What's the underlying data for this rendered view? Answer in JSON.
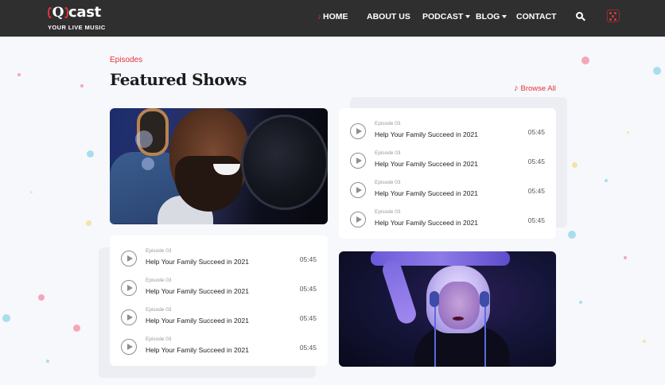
{
  "header": {
    "logo": {
      "mark": "Q",
      "word": "cast",
      "tagline": "YOUR LIVE MUSIC"
    },
    "nav": [
      {
        "label": "HOME",
        "active": true
      },
      {
        "label": "ABOUT US",
        "dropdown": false
      },
      {
        "label": "PODCAST",
        "dropdown": true
      },
      {
        "label": "BLOG",
        "dropdown": true
      },
      {
        "label": "CONTACT",
        "dropdown": false
      }
    ],
    "icons": {
      "search": "search-icon",
      "menu": "menu-grid-icon",
      "music": "music-note-icon"
    }
  },
  "section": {
    "eyebrow": "Episodes",
    "title": "Featured Shows",
    "browse": "Browse All"
  },
  "lists": [
    {
      "episodes": [
        {
          "label": "Episode 03",
          "title": "Help Your Family Succeed in 2021",
          "duration": "05:45"
        },
        {
          "label": "Episode 03",
          "title": "Help Your Family Succeed in 2021",
          "duration": "05:45"
        },
        {
          "label": "Episode 03",
          "title": "Help Your Family Succeed in 2021",
          "duration": "05:45"
        },
        {
          "label": "Episode 03",
          "title": "Help Your Family Succeed in 2021",
          "duration": "05:45"
        }
      ]
    },
    {
      "episodes": [
        {
          "label": "Episode 03",
          "title": "Help Your Family Succeed in 2021",
          "duration": "05:45"
        },
        {
          "label": "Episode 03",
          "title": "Help Your Family Succeed in 2021",
          "duration": "05:45"
        },
        {
          "label": "Episode 03",
          "title": "Help Your Family Succeed in 2021",
          "duration": "05:45"
        },
        {
          "label": "Episode 03",
          "title": "Help Your Family Succeed in 2021",
          "duration": "05:45"
        }
      ]
    }
  ],
  "colors": {
    "accent": "#e8323c",
    "header_bg": "#2f2f2f",
    "page_bg": "#f6f8fb"
  }
}
